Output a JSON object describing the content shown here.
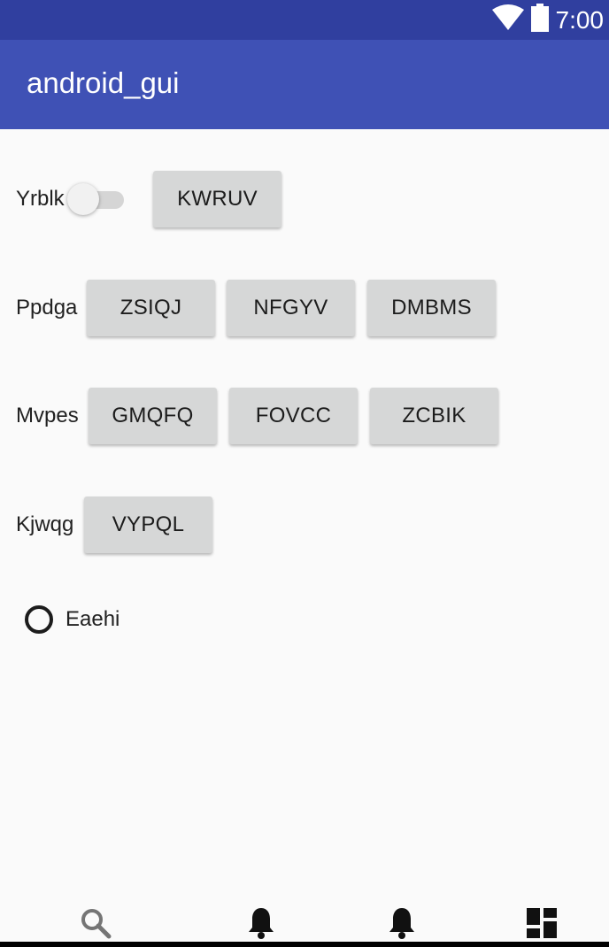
{
  "status_bar": {
    "time": "7:00",
    "icons": [
      "wifi-icon",
      "battery-icon"
    ]
  },
  "app_bar": {
    "title": "android_gui"
  },
  "rows": [
    {
      "label": "Yrblk",
      "switch": {
        "checked": false
      },
      "buttons": [
        "KWRUV"
      ]
    },
    {
      "label": "Ppdga",
      "buttons": [
        "ZSIQJ",
        "NFGYV",
        "DMBMS"
      ]
    },
    {
      "label": "Mvpes",
      "buttons": [
        "GMQFQ",
        "FOVCC",
        "ZCBIK"
      ]
    },
    {
      "label": "Kjwqg",
      "buttons": [
        "VYPQL"
      ]
    }
  ],
  "radio": {
    "label": "Eaehi",
    "checked": false
  },
  "bottom_nav": {
    "items": [
      "search-icon",
      "notifications-icon",
      "notifications-icon",
      "dashboard-icon"
    ]
  },
  "colors": {
    "status_bar": "#303f9f",
    "app_bar": "#3f51b5",
    "button": "#d6d7d7",
    "background": "#fafafa"
  }
}
